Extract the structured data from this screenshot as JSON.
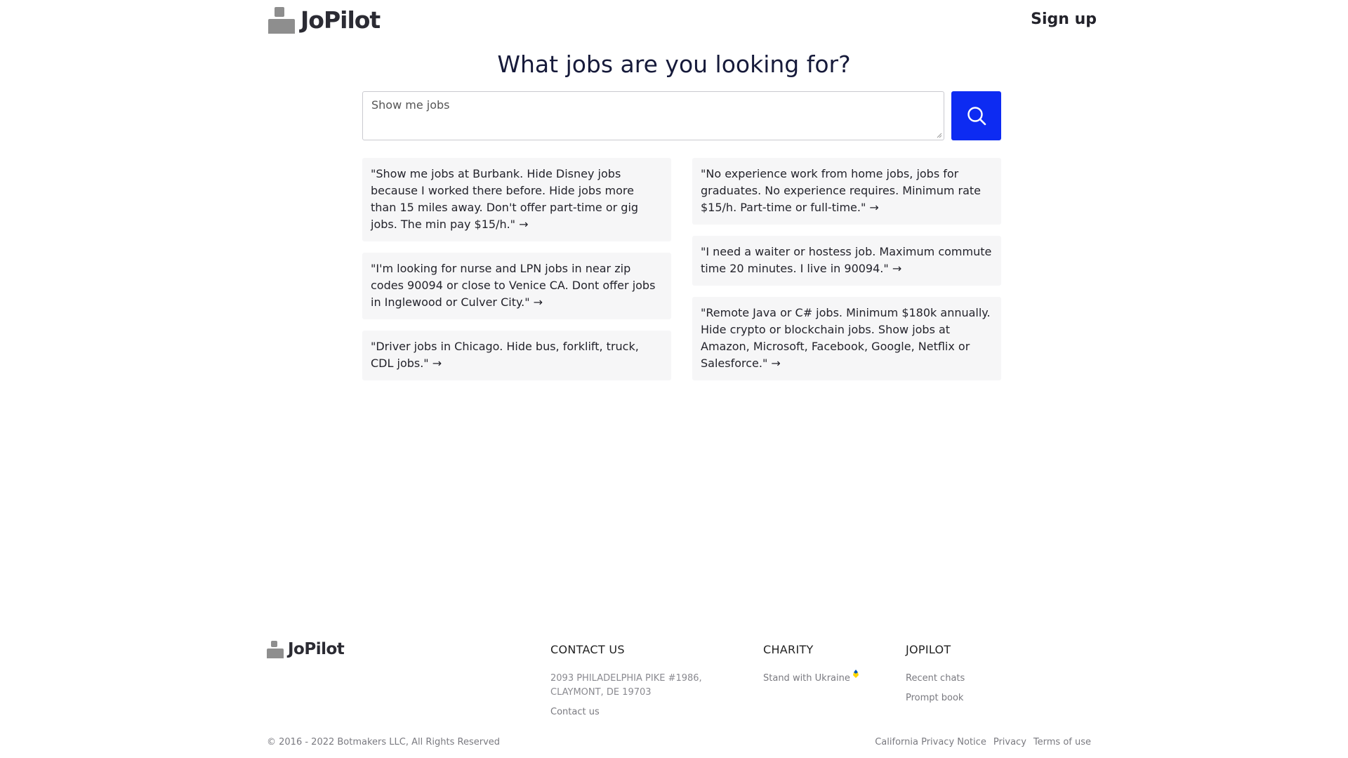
{
  "header": {
    "logo_text": "JoPilot",
    "signup_label": "Sign up"
  },
  "main": {
    "title": "What jobs are you looking for?",
    "search_placeholder": "Show me jobs",
    "search_value": ""
  },
  "examples": {
    "left": [
      "\"Show me jobs at Burbank. Hide Disney jobs because I worked there before. Hide jobs more than 15 miles away. Don't offer part-time or gig jobs. The min pay $15/h.\" →",
      "\"I'm looking for nurse and LPN jobs in near zip codes 90094 or close to Venice CA. Dont offer jobs in Inglewood or Culver City.\" →",
      "\"Driver jobs in Chicago. Hide bus, forklift, truck, CDL jobs.\" →"
    ],
    "right": [
      "\"No experience work from home jobs, jobs for graduates. No experience requires. Minimum rate $15/h. Part-time or full-time.\" →",
      "\"I need a waiter or hostess job. Maximum commute time 20 minutes. I live in 90094.\" →",
      "\"Remote Java or C# jobs. Minimum $180k annually. Hide crypto or blockchain jobs. Show jobs at Amazon, Microsoft, Facebook, Google, Netflix or Salesforce.\" →"
    ]
  },
  "footer": {
    "logo_text": "JoPilot",
    "contact": {
      "heading": "CONTACT US",
      "address": "2093 PHILADELPHIA PIKE #1986, CLAYMONT, DE 19703",
      "link": "Contact us"
    },
    "charity": {
      "heading": "CHARITY",
      "link": "Stand with Ukraine"
    },
    "jopilot": {
      "heading": "JOPILOT",
      "links": [
        "Recent chats",
        "Prompt book"
      ]
    },
    "copyright": "© 2016 - 2022 Botmakers LLC, All Rights Reserved",
    "legal": [
      "California Privacy Notice",
      "Privacy",
      "Terms of use"
    ]
  },
  "colors": {
    "accent": "#0d2bf2",
    "card_bg": "#f6f6f7",
    "logo_gray": "#8e8e8e",
    "ukraine_blue": "#0057b7",
    "ukraine_yellow": "#ffd700"
  },
  "icons": {
    "search": "search-icon",
    "logo": "person-logo-icon",
    "ukraine": "ukraine-flag-icon"
  }
}
